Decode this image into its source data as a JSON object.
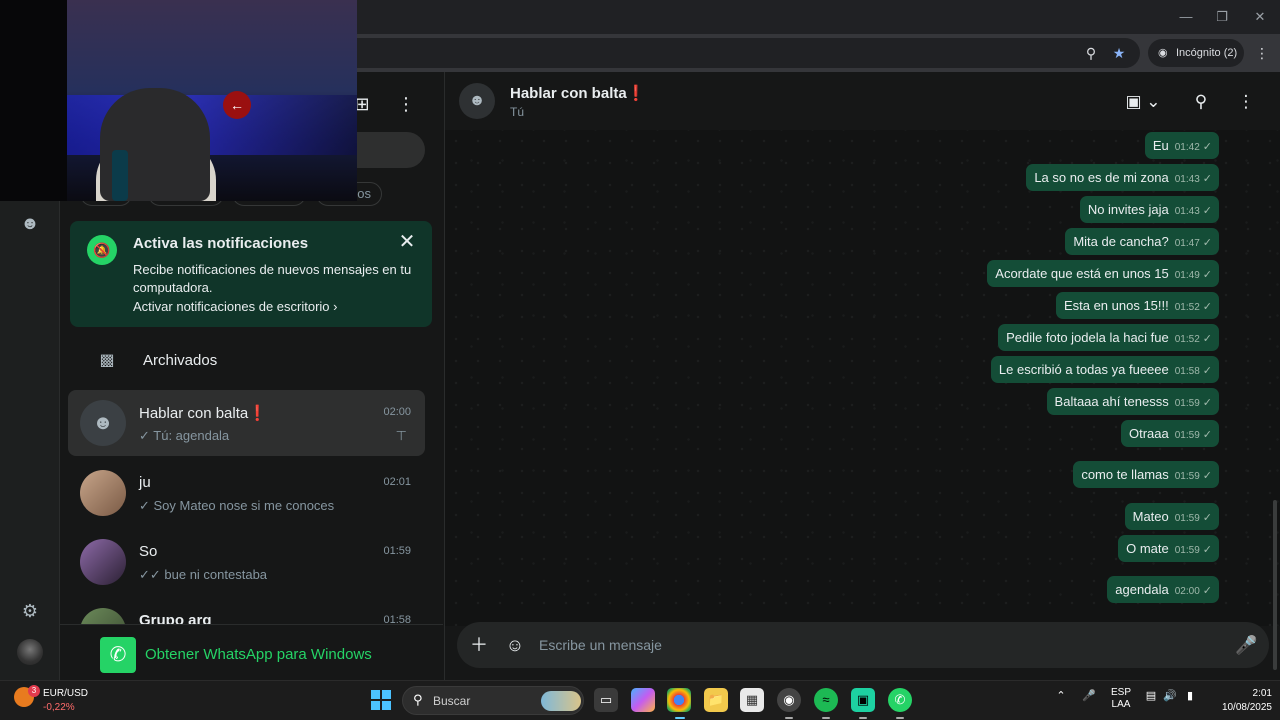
{
  "browser": {
    "incognito_label": "Incógnito (2)",
    "minimize_icon": "minimize-icon",
    "maximize_icon": "maximize-icon",
    "close_icon": "close-icon"
  },
  "rail": {
    "icons": [
      "communities-icon",
      "settings-icon",
      "profile-avatar"
    ]
  },
  "list": {
    "filter_chip_partial": "os",
    "notification": {
      "title": "Activa las notificaciones",
      "body": "Recibe notificaciones de nuevos mensajes en tu computadora.",
      "link": "Activar notificaciones de escritorio"
    },
    "archived_label": "Archivados",
    "chats": [
      {
        "name": "Hablar con balta",
        "mark": "❗",
        "time": "02:00",
        "preview": "✓ Tú: agendala",
        "pinned": true
      },
      {
        "name": "ju",
        "mark": "",
        "time": "02:01",
        "preview": "✓ Soy Mateo nose si me conoces",
        "pinned": false
      },
      {
        "name": "So",
        "mark": "",
        "time": "01:59",
        "preview": "✓✓ bue ni contestaba",
        "pinned": false
      },
      {
        "name": "Grupo arg",
        "mark": "",
        "time": "01:58",
        "preview": "",
        "pinned": false
      }
    ],
    "get_app_label": "Obtener WhatsApp para Windows"
  },
  "conversation": {
    "title": "Hablar con balta",
    "title_mark": "❗",
    "subtitle": "Tú",
    "messages": [
      {
        "text": "Eu",
        "time": "01:42"
      },
      {
        "text": "La so no es de mi zona",
        "time": "01:43"
      },
      {
        "text": "No invites jaja",
        "time": "01:43"
      },
      {
        "text": "Mita de cancha?",
        "time": "01:47"
      },
      {
        "text": "Acordate que está en unos 15",
        "time": "01:49"
      },
      {
        "text": "Esta en unos 15!!!",
        "time": "01:52"
      },
      {
        "text": "Pedile foto jodela la haci fue",
        "time": "01:52"
      },
      {
        "text": "Le escribió a todas ya fueeee",
        "time": "01:58"
      },
      {
        "text": "Baltaaa ahí tenesss",
        "time": "01:59"
      },
      {
        "text": "Otraaa",
        "time": "01:59"
      },
      {
        "text": "como te llamas",
        "time": "01:59"
      },
      {
        "text": "Mateo",
        "time": "01:59"
      },
      {
        "text": "O mate",
        "time": "01:59"
      },
      {
        "text": "agendala",
        "time": "02:00"
      }
    ],
    "composer_placeholder": "Escribe un mensaje"
  },
  "taskbar": {
    "weather_badge": "3",
    "ticker_symbol": "EUR/USD",
    "ticker_change": "-0,22%",
    "search_label": "Buscar",
    "lang_line1": "ESP",
    "lang_line2": "LAA",
    "time": "2:01",
    "date": "10/08/2025"
  },
  "colors": {
    "bubble_out": "#144d37",
    "accent": "#25d366",
    "panel": "#161717"
  }
}
